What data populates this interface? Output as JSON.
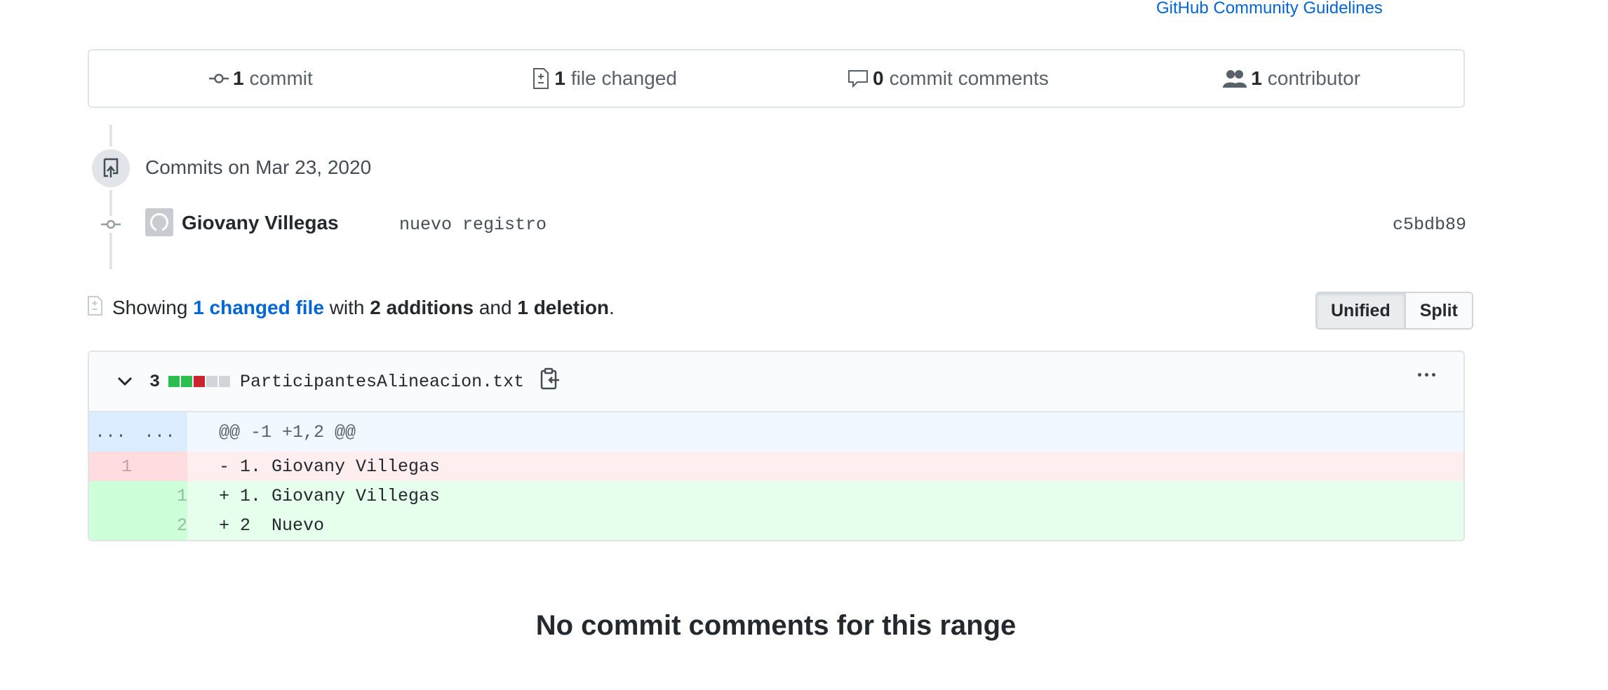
{
  "header": {
    "guidelines_link": "GitHub Community Guidelines"
  },
  "summary": {
    "commits": {
      "count": "1",
      "label": "commit"
    },
    "files": {
      "count": "1",
      "label": "file changed"
    },
    "comments": {
      "count": "0",
      "label": "commit comments"
    },
    "contributors": {
      "count": "1",
      "label": "contributor"
    }
  },
  "timeline": {
    "date_label": "Commits on Mar 23, 2020",
    "commit": {
      "author": "Giovany Villegas",
      "message": "nuevo registro",
      "sha": "c5bdb89"
    }
  },
  "showing": {
    "prefix": "Showing",
    "changed_link": "1 changed file",
    "with": "with",
    "additions": "2 additions",
    "and": "and",
    "deletions": "1 deletion",
    "suffix": "."
  },
  "view_toggle": {
    "unified": "Unified",
    "split": "Split",
    "selected": "Unified"
  },
  "file": {
    "change_count": "3",
    "diffstat_colors": [
      "#2cbe4e",
      "#2cbe4e",
      "#cb2431",
      "#d1d5da",
      "#d1d5da"
    ],
    "filename": "ParticipantesAlineacion.txt",
    "hunk": {
      "left": "...",
      "right": "...",
      "header": "@@ -1 +1,2 @@"
    },
    "lines": [
      {
        "type": "del",
        "old": "1",
        "new": "",
        "text": "- 1. Giovany Villegas"
      },
      {
        "type": "add",
        "old": "",
        "new": "1",
        "text": "+ 1. Giovany Villegas"
      },
      {
        "type": "add",
        "old": "",
        "new": "2",
        "text": "+ 2  Nuevo"
      }
    ]
  },
  "footer": {
    "no_comments": "No commit comments for this range"
  },
  "colors": {
    "link": "#0366d6",
    "add_bg": "#e6ffed",
    "del_bg": "#ffeef0",
    "hunk_bg": "#f1f8ff"
  }
}
